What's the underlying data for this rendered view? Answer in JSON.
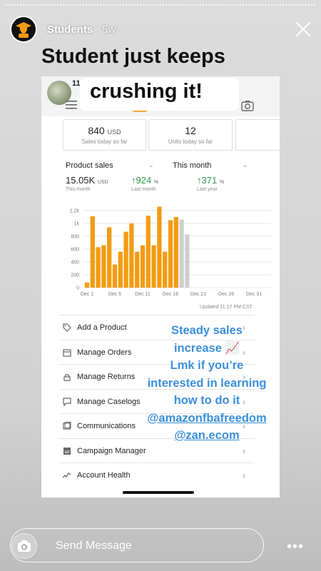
{
  "header": {
    "username": "Students",
    "time_ago": "5w",
    "close_icon": "close-icon"
  },
  "screenshot": {
    "top_count": "11",
    "stats": [
      {
        "value": "840",
        "unit": "USD",
        "label": "Sales today so far"
      },
      {
        "value": "12",
        "unit": "",
        "label": "Units today so far"
      }
    ],
    "filters": {
      "left": "Product sales",
      "right": "This month"
    },
    "metrics": [
      {
        "value": "15.05K",
        "unit": "USD",
        "label": "This month",
        "trend": ""
      },
      {
        "value": "924",
        "unit": "%",
        "label": "Last month",
        "trend": "↑"
      },
      {
        "value": "371",
        "unit": "%",
        "label": "Last year",
        "trend": "↑"
      }
    ],
    "updated": "Updated 11:17 PM CST",
    "menu": [
      {
        "label": "Add a Product",
        "icon": "tag-icon"
      },
      {
        "label": "Manage Orders",
        "icon": "box-icon"
      },
      {
        "label": "Manage Returns",
        "icon": "return-icon"
      },
      {
        "label": "Manage Caselogs",
        "icon": "chat-icon"
      },
      {
        "label": "Communications",
        "icon": "message-icon"
      },
      {
        "label": "Campaign Manager",
        "icon": "ad-icon"
      },
      {
        "label": "Account Health",
        "icon": "pulse-icon"
      }
    ]
  },
  "chart_data": {
    "type": "bar",
    "x_ticks": [
      "Dec 1",
      "Dec 6",
      "Dec 11",
      "Dec 16",
      "Dec 21",
      "Dec 26",
      "Dec 31"
    ],
    "y_ticks": [
      "0",
      "200",
      "400",
      "600",
      "800",
      "1k",
      "1.2k"
    ],
    "ylim": [
      0,
      1200
    ],
    "series": [
      {
        "color": "#f39c12",
        "values": [
          80,
          1110,
          630,
          660,
          940,
          360,
          560,
          870,
          1000,
          560,
          660,
          1120,
          660,
          1260,
          560,
          1050,
          1100
        ]
      },
      {
        "color": "#cfcfcf",
        "values": [
          1060,
          830
        ]
      }
    ]
  },
  "title": {
    "line1": "Student just keeps",
    "line2": "crushing it!"
  },
  "caption": {
    "lines": [
      "Steady sales",
      "increase 📈",
      "Lmk if you’re",
      "interested in learning",
      "how to do it"
    ],
    "mentions": [
      "@amazonfbafreedom",
      "@zan.ecom"
    ]
  },
  "reply": {
    "placeholder": "Send Message",
    "camera_icon": "camera-icon",
    "more_icon": "more-icon",
    "more_glyph": "•••"
  }
}
